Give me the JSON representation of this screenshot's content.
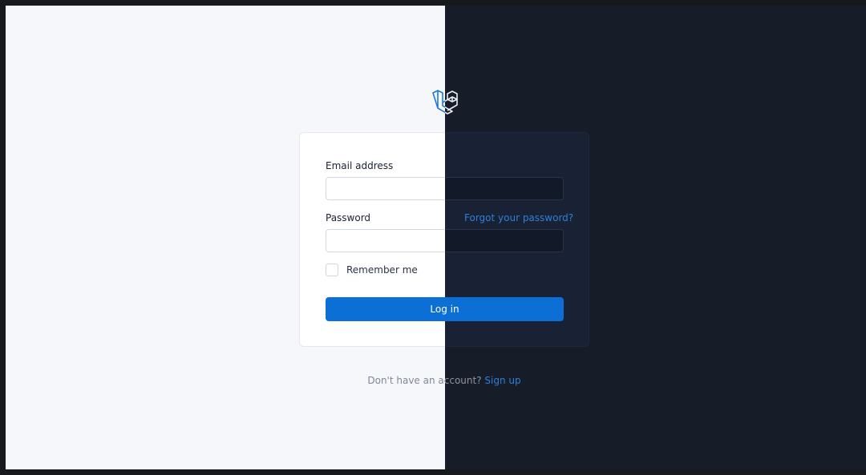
{
  "auth": {
    "email_label": "Email address",
    "password_label": "Password",
    "forgot_password": "Forgot your password?",
    "remember_me": "Remember me",
    "login_button": "Log in",
    "no_account_text": "Don't have an account?",
    "sign_up_link": "Sign up"
  },
  "colors": {
    "light_bg": "#f6f7fa",
    "dark_bg": "#161d29",
    "accent": "#0c6fd6",
    "link": "#2f7fd9"
  },
  "icons": {
    "logo": "laravel-logo-icon"
  }
}
